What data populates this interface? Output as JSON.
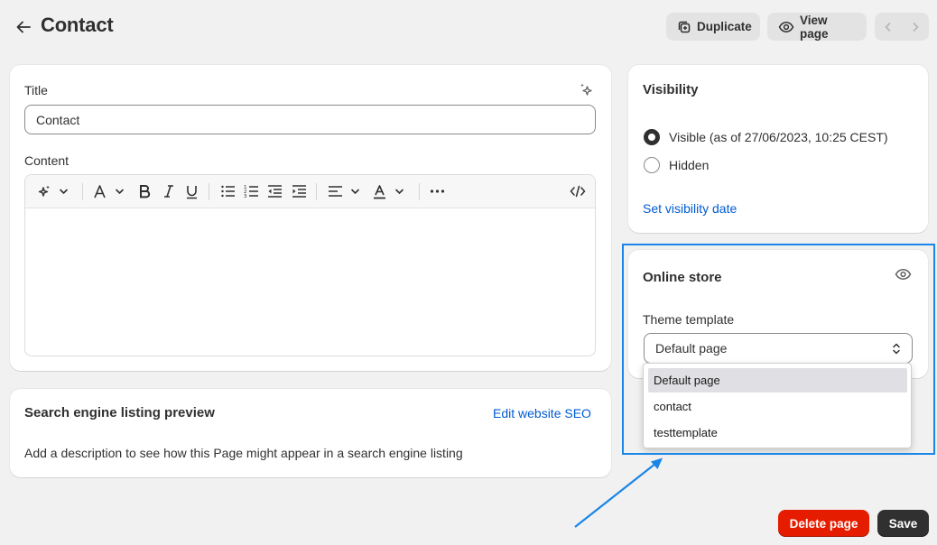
{
  "header": {
    "title": "Contact",
    "duplicate_label": "Duplicate",
    "view_page_label": "View page"
  },
  "main_card": {
    "title_label": "Title",
    "title_value": "Contact",
    "content_label": "Content"
  },
  "seo": {
    "heading": "Search engine listing preview",
    "edit_link": "Edit website SEO",
    "description": "Add a description to see how this Page might appear in a search engine listing"
  },
  "visibility": {
    "heading": "Visibility",
    "options": [
      {
        "label": "Visible (as of 27/06/2023, 10:25 CEST)",
        "checked": true
      },
      {
        "label": "Hidden",
        "checked": false
      }
    ],
    "set_date_link": "Set visibility date"
  },
  "online_store": {
    "heading": "Online store",
    "template_label": "Theme template",
    "selected_value": "Default page",
    "options": [
      "Default page",
      "contact",
      "testtemplate"
    ]
  },
  "footer": {
    "delete_label": "Delete page",
    "save_label": "Save"
  },
  "colors": {
    "background": "#f1f1f1",
    "link": "#005bd3",
    "danger": "#e51c00",
    "primary": "#303030",
    "annotation": "#1a86e8"
  }
}
